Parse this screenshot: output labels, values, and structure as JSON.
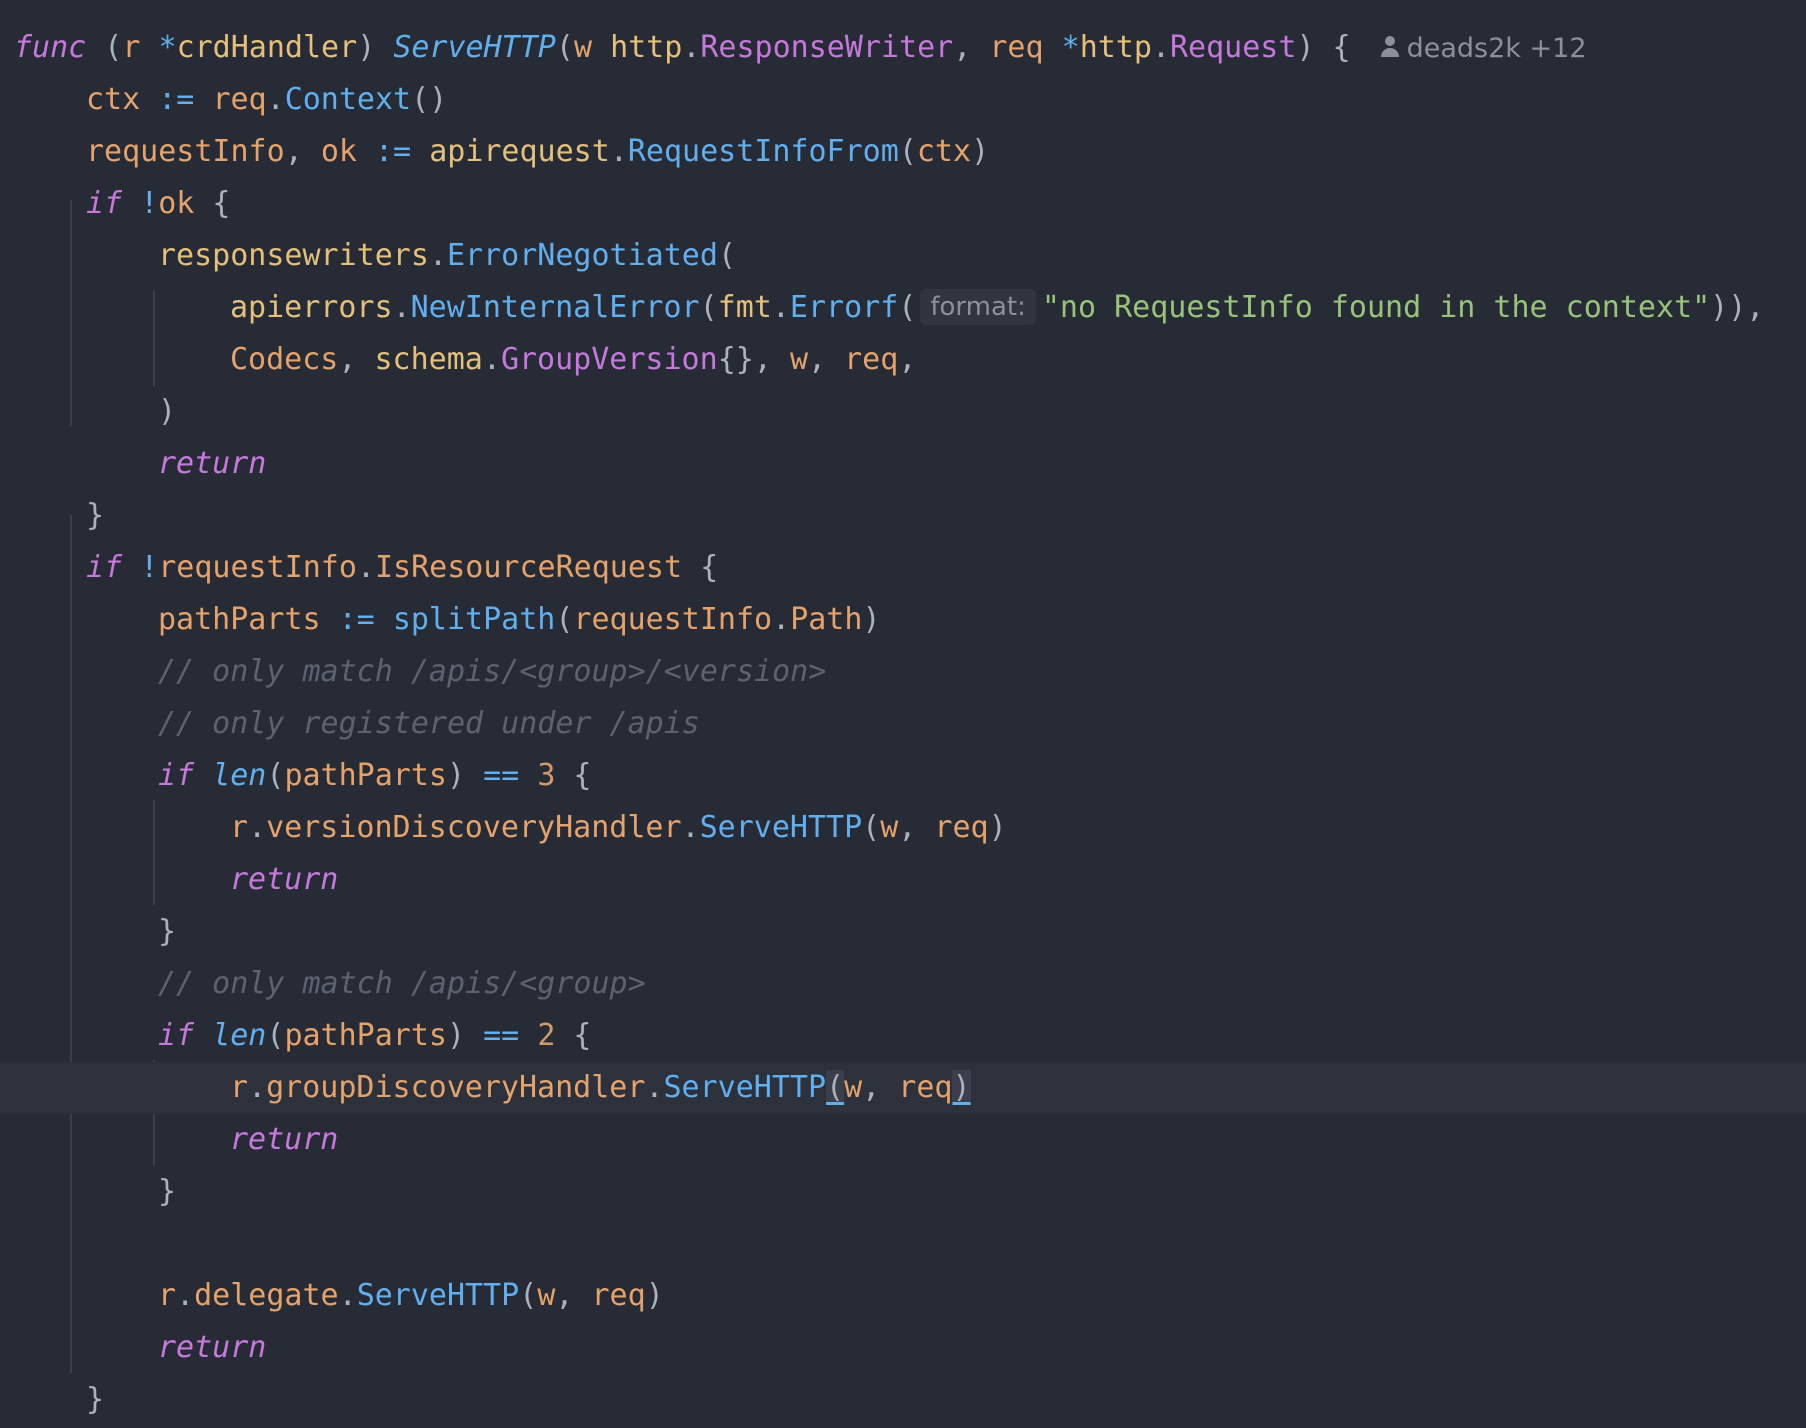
{
  "editor": {
    "blame": {
      "author": "deads2k",
      "count": "+12",
      "icon": "person-icon"
    },
    "inlay_hint": "format:",
    "lines": [
      [
        "func",
        " (",
        "r",
        " ",
        "*",
        "crdHandler",
        ") ",
        "ServeHTTP",
        "(",
        "w",
        " ",
        "http",
        ".",
        "ResponseWriter",
        ", ",
        "req",
        " ",
        "*",
        "http",
        ".",
        "Request",
        ") {"
      ],
      [
        "ctx",
        " ",
        ":=",
        " ",
        "req",
        ".",
        "Context",
        "()"
      ],
      [
        "requestInfo",
        ", ",
        "ok",
        " ",
        ":=",
        " ",
        "apirequest",
        ".",
        "RequestInfoFrom",
        "(",
        "ctx",
        ")"
      ],
      [
        "if",
        " ",
        "!",
        "ok",
        " {"
      ],
      [
        "responsewriters",
        ".",
        "ErrorNegotiated",
        "("
      ],
      [
        "apierrors",
        ".",
        "NewInternalError",
        "(",
        "fmt",
        ".",
        "Errorf",
        "(",
        "\"no RequestInfo found in the context\"",
        ")),"
      ],
      [
        "Codecs",
        ", ",
        "schema",
        ".",
        "GroupVersion",
        "{}, ",
        "w",
        ", ",
        "req",
        ","
      ],
      [
        ")"
      ],
      [
        "return"
      ],
      [
        "}"
      ],
      [
        "if",
        " ",
        "!",
        "requestInfo",
        ".",
        "IsResourceRequest",
        " {"
      ],
      [
        "pathParts",
        " ",
        ":=",
        " ",
        "splitPath",
        "(",
        "requestInfo",
        ".",
        "Path",
        ")"
      ],
      [
        "// only match /apis/<group>/<version>"
      ],
      [
        "// only registered under /apis"
      ],
      [
        "if",
        " ",
        "len",
        "(",
        "pathParts",
        ") ",
        "==",
        " ",
        "3",
        " {"
      ],
      [
        "r",
        ".",
        "versionDiscoveryHandler",
        ".",
        "ServeHTTP",
        "(",
        "w",
        ", ",
        "req",
        ")"
      ],
      [
        "return"
      ],
      [
        "}"
      ],
      [
        "// only match /apis/<group>"
      ],
      [
        "if",
        " ",
        "len",
        "(",
        "pathParts",
        ") ",
        "==",
        " ",
        "2",
        " {"
      ],
      [
        "r",
        ".",
        "groupDiscoveryHandler",
        ".",
        "ServeHTTP",
        "(",
        "w",
        ", ",
        "req",
        ")"
      ],
      [
        "return"
      ],
      [
        "}"
      ],
      [
        "r",
        ".",
        "delegate",
        ".",
        "ServeHTTP",
        "(",
        "w",
        ", ",
        "req",
        ")"
      ],
      [
        "return"
      ],
      [
        "}"
      ]
    ]
  }
}
